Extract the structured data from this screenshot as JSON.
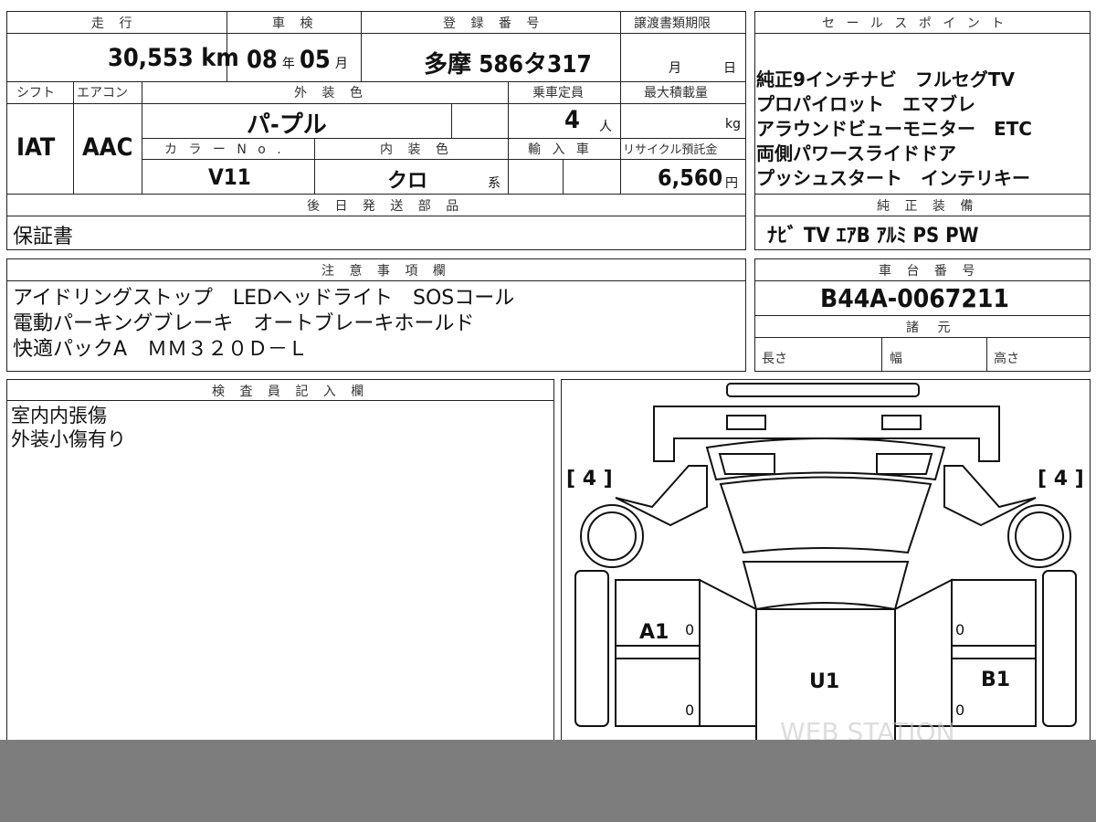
{
  "top_row": {
    "odometer_header": "走 行",
    "odometer_value": "30,553",
    "odometer_unit": "km",
    "inspection_header": "車 検",
    "inspection_year": "08",
    "inspection_year_unit": "年",
    "inspection_month": "05",
    "inspection_month_unit": "月",
    "registration_header": "登 録 番 号",
    "registration_value": "多摩 586タ317",
    "transfer_header": "譲渡書類期限",
    "transfer_month_unit": "月",
    "transfer_day_unit": "日"
  },
  "second_row": {
    "shift_header": "シフト",
    "shift_value": "IAT",
    "aircon_header": "エアコン",
    "aircon_value": "AAC",
    "exterior_color_header": "外 装 色",
    "exterior_color_value": "パ-プル",
    "capacity_header": "乗車定員",
    "capacity_value": "4",
    "capacity_unit": "人",
    "max_load_header": "最大積載量",
    "max_load_unit": "kg",
    "color_no_header": "カ ラ ー N o .",
    "color_no_value": "V11",
    "interior_color_header": "内 装 色",
    "interior_color_value": "クロ",
    "interior_color_suffix": "系",
    "import_header": "輸 入 車",
    "recycle_header": "リサイクル預託金",
    "recycle_value": "6,560",
    "recycle_unit": "円"
  },
  "later_parts": {
    "header": "後 日 発 送 部 品",
    "value": "保証書"
  },
  "sales_points": {
    "header": "セ ー ル ス ポ イ ン ト",
    "lines": [
      "純正9インチナビ　フルセグTV",
      "プロパイロット　エマブレ",
      "アラウンドビューモニター　ETC",
      "両側パワースライドドア",
      "プッシュスタート　インテリキー"
    ]
  },
  "genuine_equipment": {
    "header": "純 正 装 備",
    "value": "ﾅﾋﾞ TV ｴｱB ｱﾙﾐ PS PW"
  },
  "notes": {
    "header": "注 意 事 項 欄",
    "lines": [
      "アイドリングストップ　LEDヘッドライト　SOSコール",
      "電動パーキングブレーキ　オートブレーキホールド",
      "快適パックA　ＭＭ３２０Ｄ－Ｌ"
    ]
  },
  "chassis": {
    "header": "車 台 番 号",
    "value": "B44A-0067211"
  },
  "specs": {
    "header": "諸 元",
    "length_label": "長さ",
    "width_label": "幅",
    "height_label": "高さ"
  },
  "inspector": {
    "header": "検 査 員 記 入 欄",
    "lines": [
      "室内内張傷",
      "外装小傷有り"
    ]
  },
  "diagram": {
    "left_tire": "[ 4 ]",
    "right_tire": "[ 4 ]",
    "marks": {
      "a1": "A1",
      "u1": "U1",
      "b1": "B1"
    },
    "small_zeros": [
      "0",
      "0",
      "0",
      "0"
    ],
    "watermark": "WEB STATION"
  }
}
